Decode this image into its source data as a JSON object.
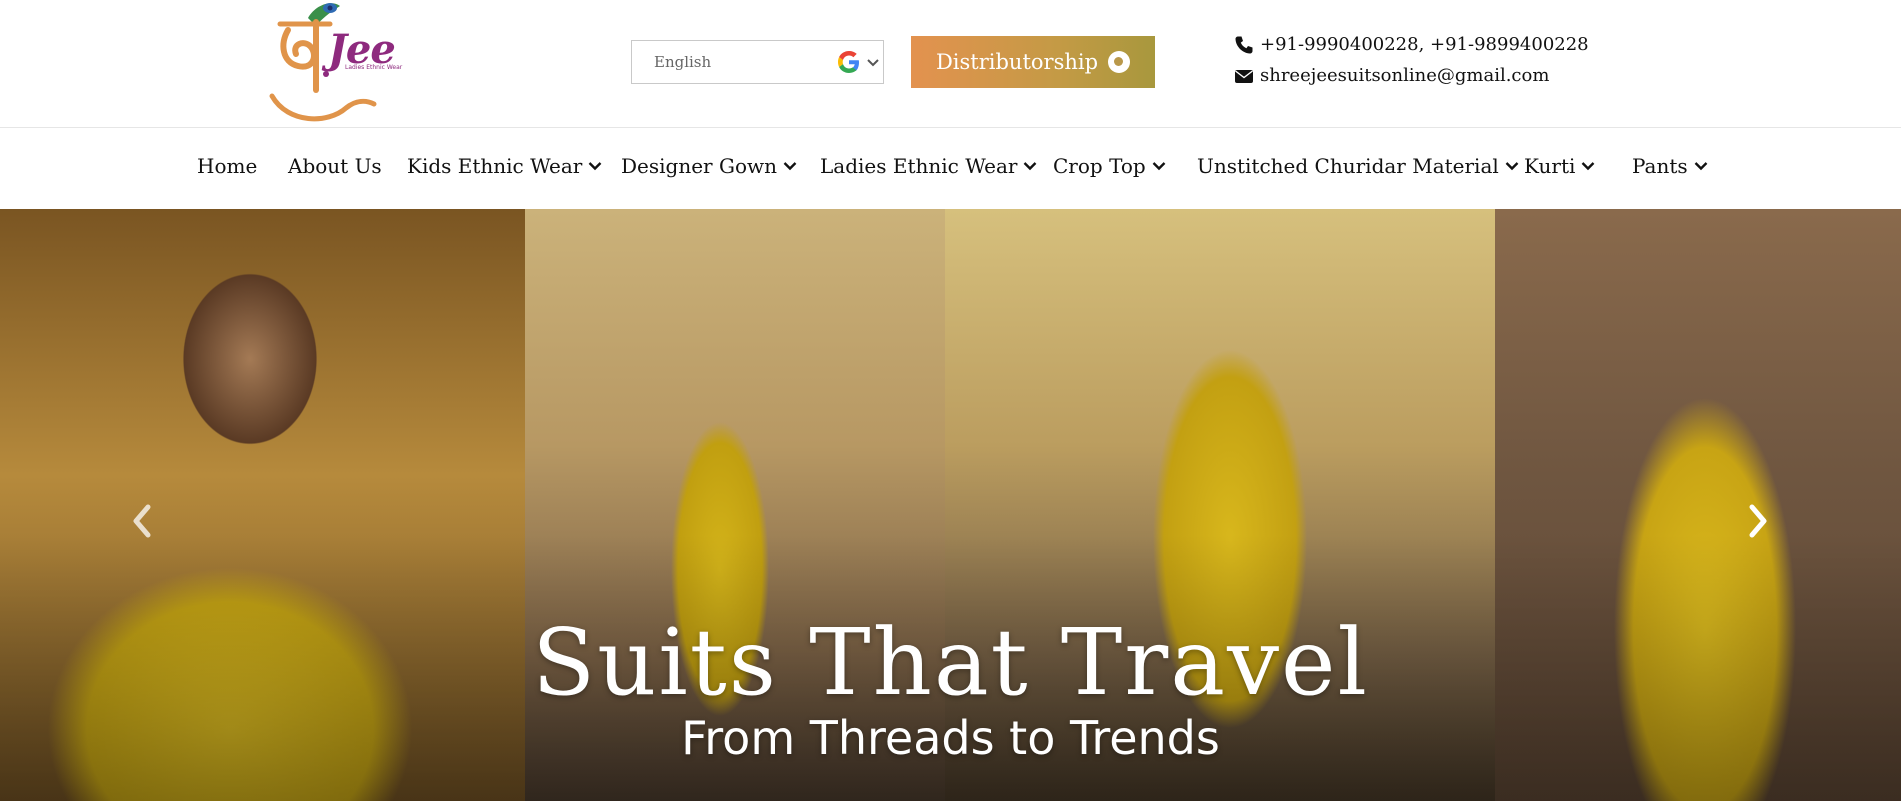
{
  "header": {
    "logo": {
      "brand_text": "Jee",
      "tagline": "Ladies Ethnic Wear"
    },
    "language_select": {
      "selected": "English",
      "icon": "google-icon"
    },
    "distributorship_button": {
      "label": "Distributorship",
      "icon": "hand-icon"
    },
    "contact": {
      "phone": "+91-9990400228, +91-9899400228",
      "phone_icon": "phone-icon",
      "email": "shreejeesuitsonline@gmail.com",
      "email_icon": "envelope-icon"
    }
  },
  "nav": {
    "items": [
      {
        "label": "Home",
        "dropdown": false
      },
      {
        "label": "About Us",
        "dropdown": false
      },
      {
        "label": "Kids Ethnic Wear",
        "dropdown": true
      },
      {
        "label": "Designer Gown",
        "dropdown": true
      },
      {
        "label": "Ladies Ethnic Wear",
        "dropdown": true
      },
      {
        "label": "Crop Top",
        "dropdown": true
      },
      {
        "label": "Unstitched Churidar Material",
        "dropdown": true
      },
      {
        "label": "Kurti",
        "dropdown": true
      },
      {
        "label": "Pants",
        "dropdown": true
      }
    ]
  },
  "hero": {
    "title": "Suits That Travel",
    "subtitle": "From Threads to Trends",
    "prev_icon": "chevron-left-icon",
    "next_icon": "chevron-right-icon"
  },
  "colors": {
    "accent_gradient_start": "#e3924f",
    "accent_gradient_end": "#a8983d",
    "logo_purple": "#8e2a7e",
    "logo_orange": "#e0944a"
  }
}
